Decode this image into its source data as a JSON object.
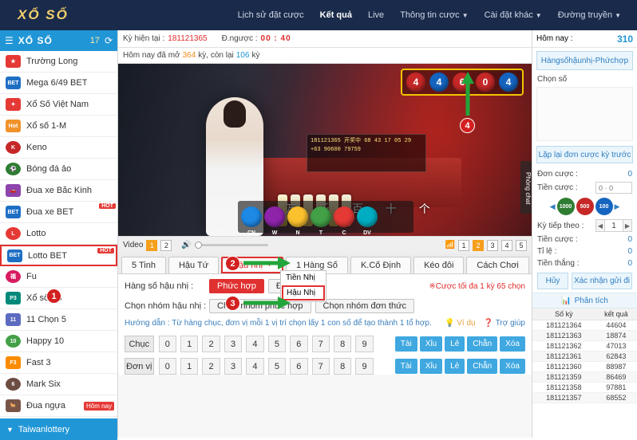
{
  "topbar": {
    "brand": "XỔ SỐ",
    "nav": [
      {
        "label": "Lịch sử đặt cược",
        "active": false,
        "caret": false
      },
      {
        "label": "Kết quả",
        "active": true,
        "caret": false
      },
      {
        "label": "Live",
        "active": false,
        "caret": false
      },
      {
        "label": "Thông tin cược",
        "active": false,
        "caret": true
      },
      {
        "label": "Cài đặt khác",
        "active": false,
        "caret": true
      },
      {
        "label": "Đường truyền",
        "active": false,
        "caret": true
      }
    ]
  },
  "sidebar": {
    "title": "XỔ SỐ",
    "count": "17",
    "refresh_icon": "refresh-icon",
    "items": [
      {
        "label": "Trường Long",
        "tag": "",
        "color": "#e53935",
        "icon": "star-icon"
      },
      {
        "label": "Mega 6/49 BET",
        "tag": "BET",
        "color": "#1e6fc4",
        "icon": "bet-icon"
      },
      {
        "label": "Xổ Số Việt Nam",
        "tag": "",
        "color": "#e53935",
        "icon": "flag-icon"
      },
      {
        "label": "Xổ số 1-M",
        "tag": "Hot",
        "color": "#f0932b",
        "icon": "ticket-icon"
      },
      {
        "label": "Keno",
        "tag": "",
        "color": "#c62828",
        "icon": "keno-icon"
      },
      {
        "label": "Bóng đá ảo",
        "tag": "",
        "color": "#2e7d32",
        "icon": "ball-icon"
      },
      {
        "label": "Đua xe Bắc Kinh",
        "tag": "",
        "color": "#8e44ad",
        "icon": "car-icon"
      },
      {
        "label": "Đua xe BET",
        "tag": "BET",
        "color": "#1e6fc4",
        "icon": "car-bet-icon",
        "hot": "HOT"
      },
      {
        "label": "Lotto",
        "tag": "",
        "color": "#e53935",
        "icon": "lotto-icon"
      },
      {
        "label": "Lotto BET",
        "tag": "BET",
        "color": "#1e6fc4",
        "icon": "lotto-bet-icon",
        "hot": "HOT",
        "selected": true
      },
      {
        "label": "Fu",
        "tag": "",
        "color": "#d81b60",
        "icon": "fu-icon"
      },
      {
        "label": "Xổ số P3",
        "tag": "",
        "color": "#00897b",
        "icon": "p3-icon"
      },
      {
        "label": "11 Chọn 5",
        "tag": "",
        "color": "#5c6bc0",
        "icon": "11x5-icon"
      },
      {
        "label": "Happy 10",
        "tag": "",
        "color": "#43a047",
        "icon": "happy-icon"
      },
      {
        "label": "Fast 3",
        "tag": "",
        "color": "#fb8c00",
        "icon": "fast3-icon"
      },
      {
        "label": "Mark Six",
        "tag": "",
        "color": "#6d4c41",
        "icon": "marksix-icon"
      },
      {
        "label": "Đua ngựa",
        "tag": "",
        "color": "#795548",
        "icon": "horse-icon",
        "today": "Hôm nay"
      }
    ],
    "footer": "Taiwanlottery"
  },
  "center": {
    "info": {
      "current_label": "Kỳ hiện tại :",
      "current_value": "181121365",
      "countdown_label": "Đ.ngược :",
      "countdown_value": "00 : 40",
      "countdown_unit": ""
    },
    "info2": {
      "prefix": "Hôm nay đã mở",
      "opened": "364",
      "mid": "kỳ, còn lại",
      "remain": "106",
      "suffix": "kỳ"
    },
    "video": {
      "screen_text": "181121365 开奖中\n68 43 17 05 29\n+63  90600 79759",
      "cn_chars": "万 千 百 十 个",
      "result_balls": [
        {
          "num": "4",
          "color": "#c62828"
        },
        {
          "num": "4",
          "color": "#1565c0"
        },
        {
          "num": "6",
          "color": "#c62828"
        },
        {
          "num": "0",
          "color": "#c62828"
        },
        {
          "num": "4",
          "color": "#1565c0"
        }
      ],
      "draw_balls": [
        {
          "num": "",
          "color": "#1e88e5",
          "sub": "CN"
        },
        {
          "num": "",
          "color": "#8e24aa",
          "sub": "W"
        },
        {
          "num": "",
          "color": "#fbc02d",
          "sub": "N"
        },
        {
          "num": "",
          "color": "#43a047",
          "sub": "T"
        },
        {
          "num": "",
          "color": "#e53935",
          "sub": "C"
        },
        {
          "num": "",
          "color": "#00acc1",
          "sub": "DV"
        }
      ],
      "chat_tab": "Phòng chat"
    },
    "videobar": {
      "label": "Video",
      "options": [
        "1",
        "2"
      ],
      "selected_video": "1",
      "volume_icon": "volume-icon",
      "wifi_icon": "wifi-icon",
      "quality": [
        "1",
        "2",
        "3",
        "4",
        "5"
      ],
      "selected_quality": "2"
    },
    "tabs": [
      {
        "label": "5 Tinh",
        "selected": false,
        "caret": false
      },
      {
        "label": "Hậu Tứ",
        "selected": false,
        "caret": false
      },
      {
        "label": "Hậu nhị",
        "selected": true,
        "caret": true
      },
      {
        "label": "1 Hàng Số",
        "selected": false,
        "caret": false
      },
      {
        "label": "K.Cố Định",
        "selected": false,
        "caret": false
      },
      {
        "label": "Kéo đôi",
        "selected": false,
        "caret": false
      },
      {
        "label": "Cách Chơi",
        "selected": false,
        "caret": false
      }
    ],
    "dropdown": {
      "items": [
        {
          "label": "Tiền Nhị",
          "selected": false
        },
        {
          "label": "Hậu Nhị",
          "selected": true
        }
      ]
    },
    "rows": [
      {
        "label": "Hàng số hậu nhị :",
        "buttons": [
          {
            "label": "Phức hợp",
            "style": "red"
          },
          {
            "label": "Đơn thức",
            "style": "plain"
          }
        ],
        "warn": "※Cược tối đa 1 kỳ 65 chọn"
      },
      {
        "label": "Chọn nhóm hậu nhị :",
        "buttons": [
          {
            "label": "Chọn nhóm phức hợp",
            "style": "plain"
          },
          {
            "label": "Chọn nhóm đơn thức",
            "style": "plain"
          }
        ],
        "warn": ""
      }
    ],
    "hint": {
      "text": "Hướng dẫn : Từ hàng chục, đơn vị mỗi 1 vị trí chọn lấy 1 con số để tạo thành 1 tổ hợp.",
      "example": "Ví dụ",
      "help": "Trợ giúp"
    },
    "grid": {
      "rows": [
        {
          "name": "Chục",
          "numbers": [
            "0",
            "1",
            "2",
            "3",
            "4",
            "5",
            "6",
            "7",
            "8",
            "9"
          ],
          "actions": [
            "Tài",
            "Xỉu",
            "Lẻ",
            "Chẵn",
            "Xóa"
          ]
        },
        {
          "name": "Đơn vị",
          "numbers": [
            "0",
            "1",
            "2",
            "3",
            "4",
            "5",
            "6",
            "7",
            "8",
            "9"
          ],
          "actions": [
            "Tài",
            "Xỉu",
            "Lẻ",
            "Chẵn",
            "Xóa"
          ]
        }
      ]
    }
  },
  "right": {
    "today_label": "Hôm nay :",
    "today_value": "310",
    "game_select": "Hàngsốhậunhị-Phứchợp",
    "choose_label": "Chọn số",
    "repeat_button": "Lặp lại đơn cược kỳ trước",
    "bet_count_label": "Đơn cược :",
    "bet_count_value": "0",
    "bet_money_label": "Tiền cược :",
    "bet_money_value": "0 · 0",
    "chips": [
      {
        "label": "1000",
        "color": "#2e7d32"
      },
      {
        "label": "500",
        "color": "#c62828"
      },
      {
        "label": "100",
        "color": "#1565c0"
      }
    ],
    "next_period_label": "Kỳ tiếp theo :",
    "next_period_value": "1",
    "amount_label": "Tiền cược :",
    "amount_value": "0",
    "rate_label": "Tỉ        lệ :",
    "rate_value": "0",
    "win_label": "Tiền thắng :",
    "win_value": "0",
    "cancel_button": "Hủy",
    "confirm_button": "Xác nhận gửi đi",
    "analysis_tab": "Phân tích",
    "analysis_icon": "chart-icon",
    "history_headers": [
      "Số kỳ",
      "kết quả"
    ],
    "history": [
      {
        "period": "181121364",
        "result": "44604"
      },
      {
        "period": "181121363",
        "result": "18874"
      },
      {
        "period": "181121362",
        "result": "47013"
      },
      {
        "period": "181121361",
        "result": "62843"
      },
      {
        "period": "181121360",
        "result": "88987"
      },
      {
        "period": "181121359",
        "result": "86469"
      },
      {
        "period": "181121358",
        "result": "97881"
      },
      {
        "period": "181121357",
        "result": "68552"
      }
    ]
  },
  "annotations": [
    {
      "num": "1"
    },
    {
      "num": "2"
    },
    {
      "num": "3"
    },
    {
      "num": "4"
    }
  ]
}
